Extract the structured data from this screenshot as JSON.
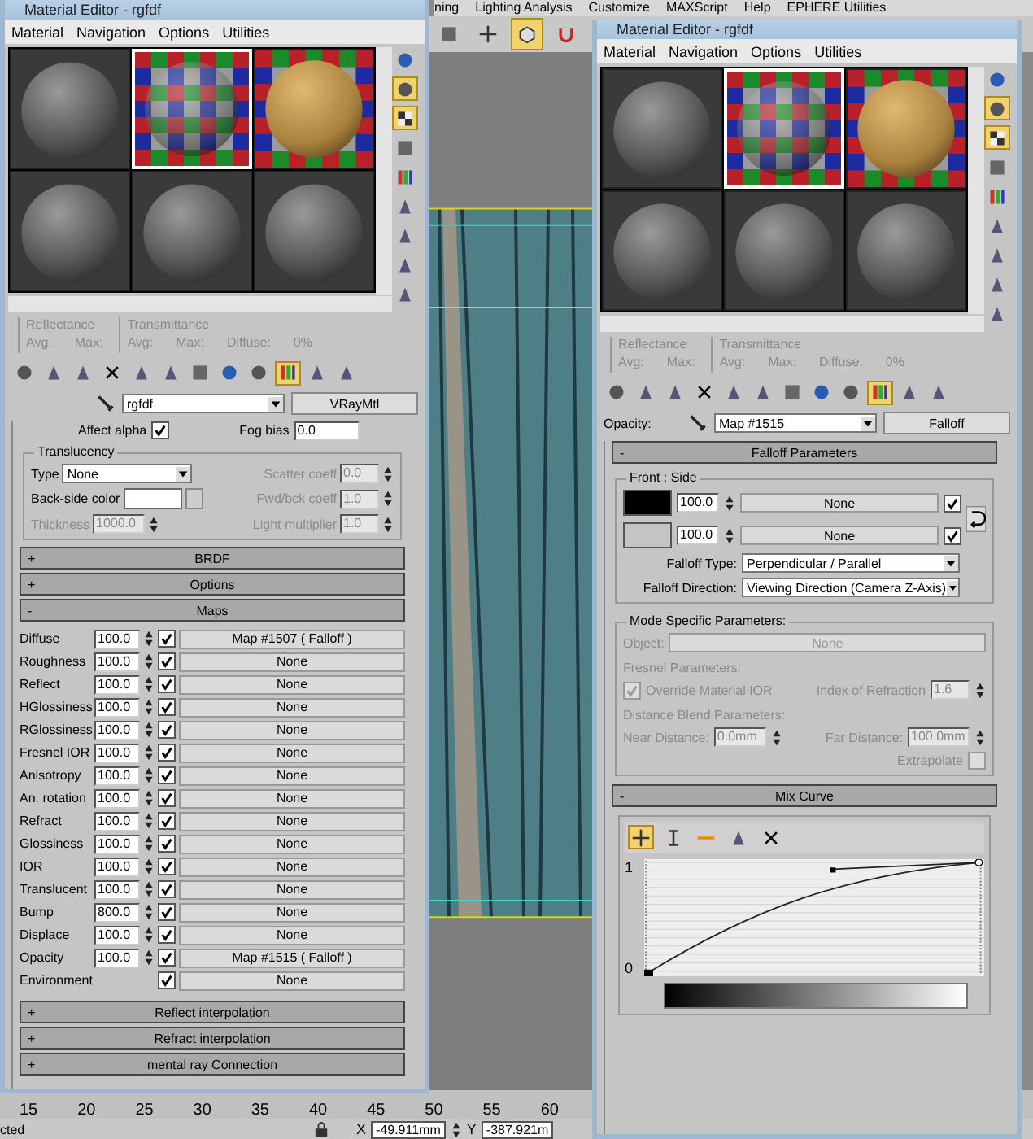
{
  "app_menu": [
    "ning",
    "Lighting Analysis",
    "Customize",
    "MAXScript",
    "Help",
    "EPHERE Utilities"
  ],
  "main_toolbar": [
    {
      "active": false
    },
    {
      "active": false
    },
    {
      "active": true
    },
    {
      "active": false
    }
  ],
  "timeline_ticks": [
    "15",
    "20",
    "25",
    "30",
    "35",
    "40",
    "45",
    "50",
    "55",
    "60"
  ],
  "status_bar": {
    "prompt": "cted",
    "x_label": "X",
    "x_value": "-49.911mm",
    "y_label": "Y",
    "y_value": "-387.921m"
  },
  "left_editor": {
    "title": "Material Editor - rgfdf",
    "menu": [
      "Material",
      "Navigation",
      "Options",
      "Utilities"
    ],
    "slots": [
      {
        "kind": "plain",
        "selected": false
      },
      {
        "kind": "checker",
        "selected": true
      },
      {
        "kind": "textured",
        "selected": false
      },
      {
        "kind": "plain",
        "selected": false
      },
      {
        "kind": "plain",
        "selected": false
      },
      {
        "kind": "plain",
        "selected": false
      }
    ],
    "side_toolbar": [
      {
        "active": false
      },
      {
        "active": true
      },
      {
        "active": true
      },
      {
        "active": false
      },
      {
        "active": false
      },
      {
        "active": false
      },
      {
        "active": false
      },
      {
        "active": false
      },
      {
        "active": false
      }
    ],
    "stats": {
      "reflectance": "Reflectance",
      "avg": "Avg:",
      "max": "Max:",
      "transmittance": "Transmittance",
      "avg_t": "Avg:",
      "max_t": "Max:",
      "diffuse": "Diffuse:",
      "diffuse_value": "0%"
    },
    "bottom_toolbar": [
      {
        "active": false
      },
      {
        "active": false
      },
      {
        "active": false
      },
      {
        "active": false
      },
      {
        "active": false
      },
      {
        "active": false
      },
      {
        "active": false
      },
      {
        "active": false
      },
      {
        "active": false
      },
      {
        "active": true
      },
      {
        "active": false
      },
      {
        "active": false
      }
    ],
    "name_value": "rgfdf",
    "type_button": "VRayMtl",
    "cut_row": {
      "affect_alpha": "Affect alpha",
      "affect_alpha_checked": true,
      "fog_bias": "Fog bias",
      "fog_bias_value": "0.0"
    },
    "translucency": {
      "title": "Translucency",
      "type_label": "Type",
      "type_value": "None",
      "back_label": "Back-side color",
      "thickness_label": "Thickness",
      "thickness_value": "1000.0",
      "scatter_label": "Scatter coeff",
      "scatter_value": "0.0",
      "fwd_label": "Fwd/bck coeff",
      "fwd_value": "1.0",
      "light_label": "Light multiplier",
      "light_value": "1.0"
    },
    "rollouts_top": [
      {
        "sign": "+",
        "title": "BRDF"
      },
      {
        "sign": "+",
        "title": "Options"
      },
      {
        "sign": "-",
        "title": "Maps"
      }
    ],
    "maps": [
      {
        "name": "Diffuse",
        "amount": "100.0",
        "checked": true,
        "map": "Map #1507  ( Falloff )"
      },
      {
        "name": "Roughness",
        "amount": "100.0",
        "checked": true,
        "map": "None"
      },
      {
        "name": "Reflect",
        "amount": "100.0",
        "checked": true,
        "map": "None"
      },
      {
        "name": "HGlossiness",
        "amount": "100.0",
        "checked": true,
        "map": "None"
      },
      {
        "name": "RGlossiness",
        "amount": "100.0",
        "checked": true,
        "map": "None"
      },
      {
        "name": "Fresnel IOR",
        "amount": "100.0",
        "checked": true,
        "map": "None"
      },
      {
        "name": "Anisotropy",
        "amount": "100.0",
        "checked": true,
        "map": "None"
      },
      {
        "name": "An. rotation",
        "amount": "100.0",
        "checked": true,
        "map": "None"
      },
      {
        "name": "Refract",
        "amount": "100.0",
        "checked": true,
        "map": "None"
      },
      {
        "name": "Glossiness",
        "amount": "100.0",
        "checked": true,
        "map": "None"
      },
      {
        "name": "IOR",
        "amount": "100.0",
        "checked": true,
        "map": "None"
      },
      {
        "name": "Translucent",
        "amount": "100.0",
        "checked": true,
        "map": "None"
      },
      {
        "name": "Bump",
        "amount": "800.0",
        "checked": true,
        "map": "None"
      },
      {
        "name": "Displace",
        "amount": "100.0",
        "checked": true,
        "map": "None"
      },
      {
        "name": "Opacity",
        "amount": "100.0",
        "checked": true,
        "map": "Map #1515  ( Falloff )"
      },
      {
        "name": "Environment",
        "checked": true,
        "map": "None"
      }
    ],
    "rollouts_bottom": [
      {
        "sign": "+",
        "title": "Reflect interpolation"
      },
      {
        "sign": "+",
        "title": "Refract interpolation"
      },
      {
        "sign": "+",
        "title": "mental ray Connection"
      }
    ]
  },
  "right_editor": {
    "title": "Material Editor - rgfdf",
    "menu": [
      "Material",
      "Navigation",
      "Options",
      "Utilities"
    ],
    "slots": [
      {
        "kind": "plain",
        "selected": false
      },
      {
        "kind": "checker",
        "selected": true
      },
      {
        "kind": "textured",
        "selected": false
      },
      {
        "kind": "plain",
        "selected": false
      },
      {
        "kind": "plain",
        "selected": false
      },
      {
        "kind": "plain",
        "selected": false
      }
    ],
    "side_toolbar": [
      {
        "active": false
      },
      {
        "active": true
      },
      {
        "active": true
      },
      {
        "active": false
      },
      {
        "active": false
      },
      {
        "active": false
      },
      {
        "active": false
      },
      {
        "active": false
      },
      {
        "active": false
      }
    ],
    "stats": {
      "reflectance": "Reflectance",
      "avg": "Avg:",
      "max": "Max:",
      "transmittance": "Transmittance",
      "avg_t": "Avg:",
      "max_t": "Max:",
      "diffuse": "Diffuse:",
      "diffuse_value": "0%"
    },
    "bottom_toolbar": [
      {
        "active": false
      },
      {
        "active": false
      },
      {
        "active": false
      },
      {
        "active": false
      },
      {
        "active": false
      },
      {
        "active": false
      },
      {
        "active": false
      },
      {
        "active": false
      },
      {
        "active": false
      },
      {
        "active": true
      },
      {
        "active": false
      },
      {
        "active": false
      }
    ],
    "map_label": "Opacity:",
    "name_value": "Map #1515",
    "type_button": "Falloff",
    "falloff": {
      "sign": "-",
      "title": "Falloff Parameters",
      "group": "Front : Side",
      "rows": [
        {
          "color": "#000000",
          "amount": "100.0",
          "map": "None",
          "checked": true
        },
        {
          "color": "#c4c4c4",
          "amount": "100.0",
          "map": "None",
          "checked": true
        }
      ],
      "type_label": "Falloff Type:",
      "type_value": "Perpendicular / Parallel",
      "direction_label": "Falloff Direction:",
      "direction_value": "Viewing Direction (Camera Z-Axis)"
    },
    "mode": {
      "title": "Mode Specific Parameters:",
      "object_label": "Object:",
      "object_value": "None",
      "fresnel_title": "Fresnel Parameters:",
      "override_label": "Override Material IOR",
      "override_checked": true,
      "ior_label": "Index of Refraction",
      "ior_value": "1.6",
      "distance_title": "Distance Blend Parameters:",
      "near_label": "Near Distance:",
      "near_value": "0.0mm",
      "far_label": "Far Distance:",
      "far_value": "100.0mm",
      "extrapolate_label": "Extrapolate",
      "extrapolate_checked": false
    },
    "mix_curve": {
      "sign": "-",
      "title": "Mix Curve",
      "tools": [
        {
          "active": true
        },
        {
          "active": false
        },
        {
          "active": false
        },
        {
          "active": false
        },
        {
          "active": false
        }
      ],
      "top_label": "1",
      "bottom_label": "0"
    }
  }
}
